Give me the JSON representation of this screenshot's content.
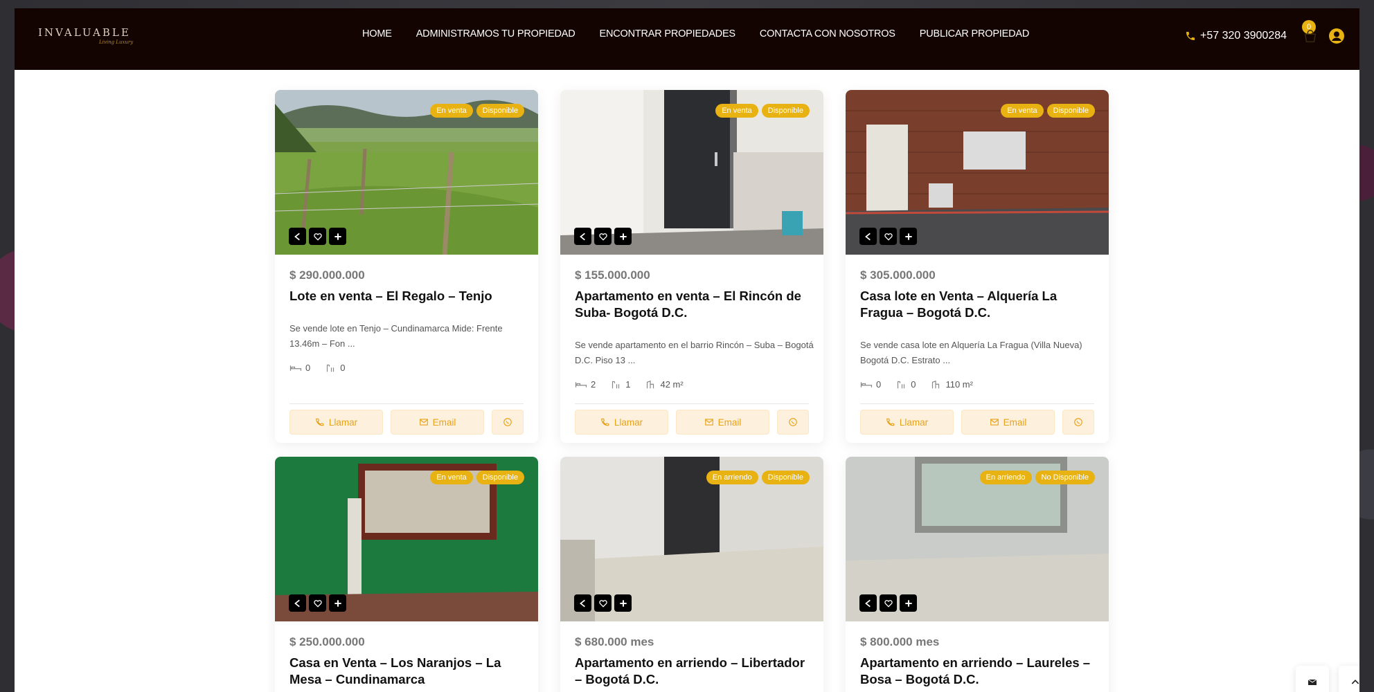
{
  "header": {
    "logo_text": "INVALUABLE",
    "logo_sub": "Living Luxury",
    "nav": [
      "HOME",
      "ADMINISTRAMOS TU PROPIEDAD",
      "ENCONTRAR PROPIEDADES",
      "CONTACTA CON NOSOTROS",
      "PUBLICAR PROPIEDAD"
    ],
    "phone": "+57 320 3900284",
    "cart_count": "0"
  },
  "colors": {
    "accent": "#e8b212",
    "header_bg": "#130402",
    "button_bg": "#fdf1dd"
  },
  "cards": [
    {
      "badges": [
        "En venta",
        "Disponible"
      ],
      "price": "$ 290.000.000",
      "title": "Lote en venta – El Regalo – Tenjo",
      "desc": "Se vende lote en Tenjo – Cundinamarca Mide: Frente 13.46m – Fon ...",
      "rooms": "0",
      "baths": "0",
      "area": "",
      "call": "Llamar",
      "email": "Email"
    },
    {
      "badges": [
        "En venta",
        "Disponible"
      ],
      "price": "$ 155.000.000",
      "title": "Apartamento en venta – El Rincón de Suba- Bogotá D.C.",
      "desc": "Se vende apartamento en el barrio Rincón – Suba – Bogotá D.C. Piso 13 ...",
      "rooms": "2",
      "baths": "1",
      "area": "42 m²",
      "call": "Llamar",
      "email": "Email"
    },
    {
      "badges": [
        "En venta",
        "Disponible"
      ],
      "price": "$ 305.000.000",
      "title": "Casa lote en Venta – Alquería La Fragua – Bogotá D.C.",
      "desc": "Se vende casa lote en Alquería La Fragua (Villa Nueva) Bogotá D.C. Estrato ...",
      "rooms": "0",
      "baths": "0",
      "area": "110 m²",
      "call": "Llamar",
      "email": "Email"
    },
    {
      "badges": [
        "En venta",
        "Disponible"
      ],
      "price": "$ 250.000.000",
      "title": "Casa en Venta – Los Naranjos – La Mesa – Cundinamarca"
    },
    {
      "badges": [
        "En arriendo",
        "Disponible"
      ],
      "price": "$ 680.000 mes",
      "title": "Apartamento en arriendo – Libertador – Bogotá D.C."
    },
    {
      "badges": [
        "En arriendo",
        "No Disponible"
      ],
      "price": "$ 800.000 mes",
      "title": "Apartamento en arriendo – Laureles – Bosa – Bogotá D.C."
    }
  ]
}
